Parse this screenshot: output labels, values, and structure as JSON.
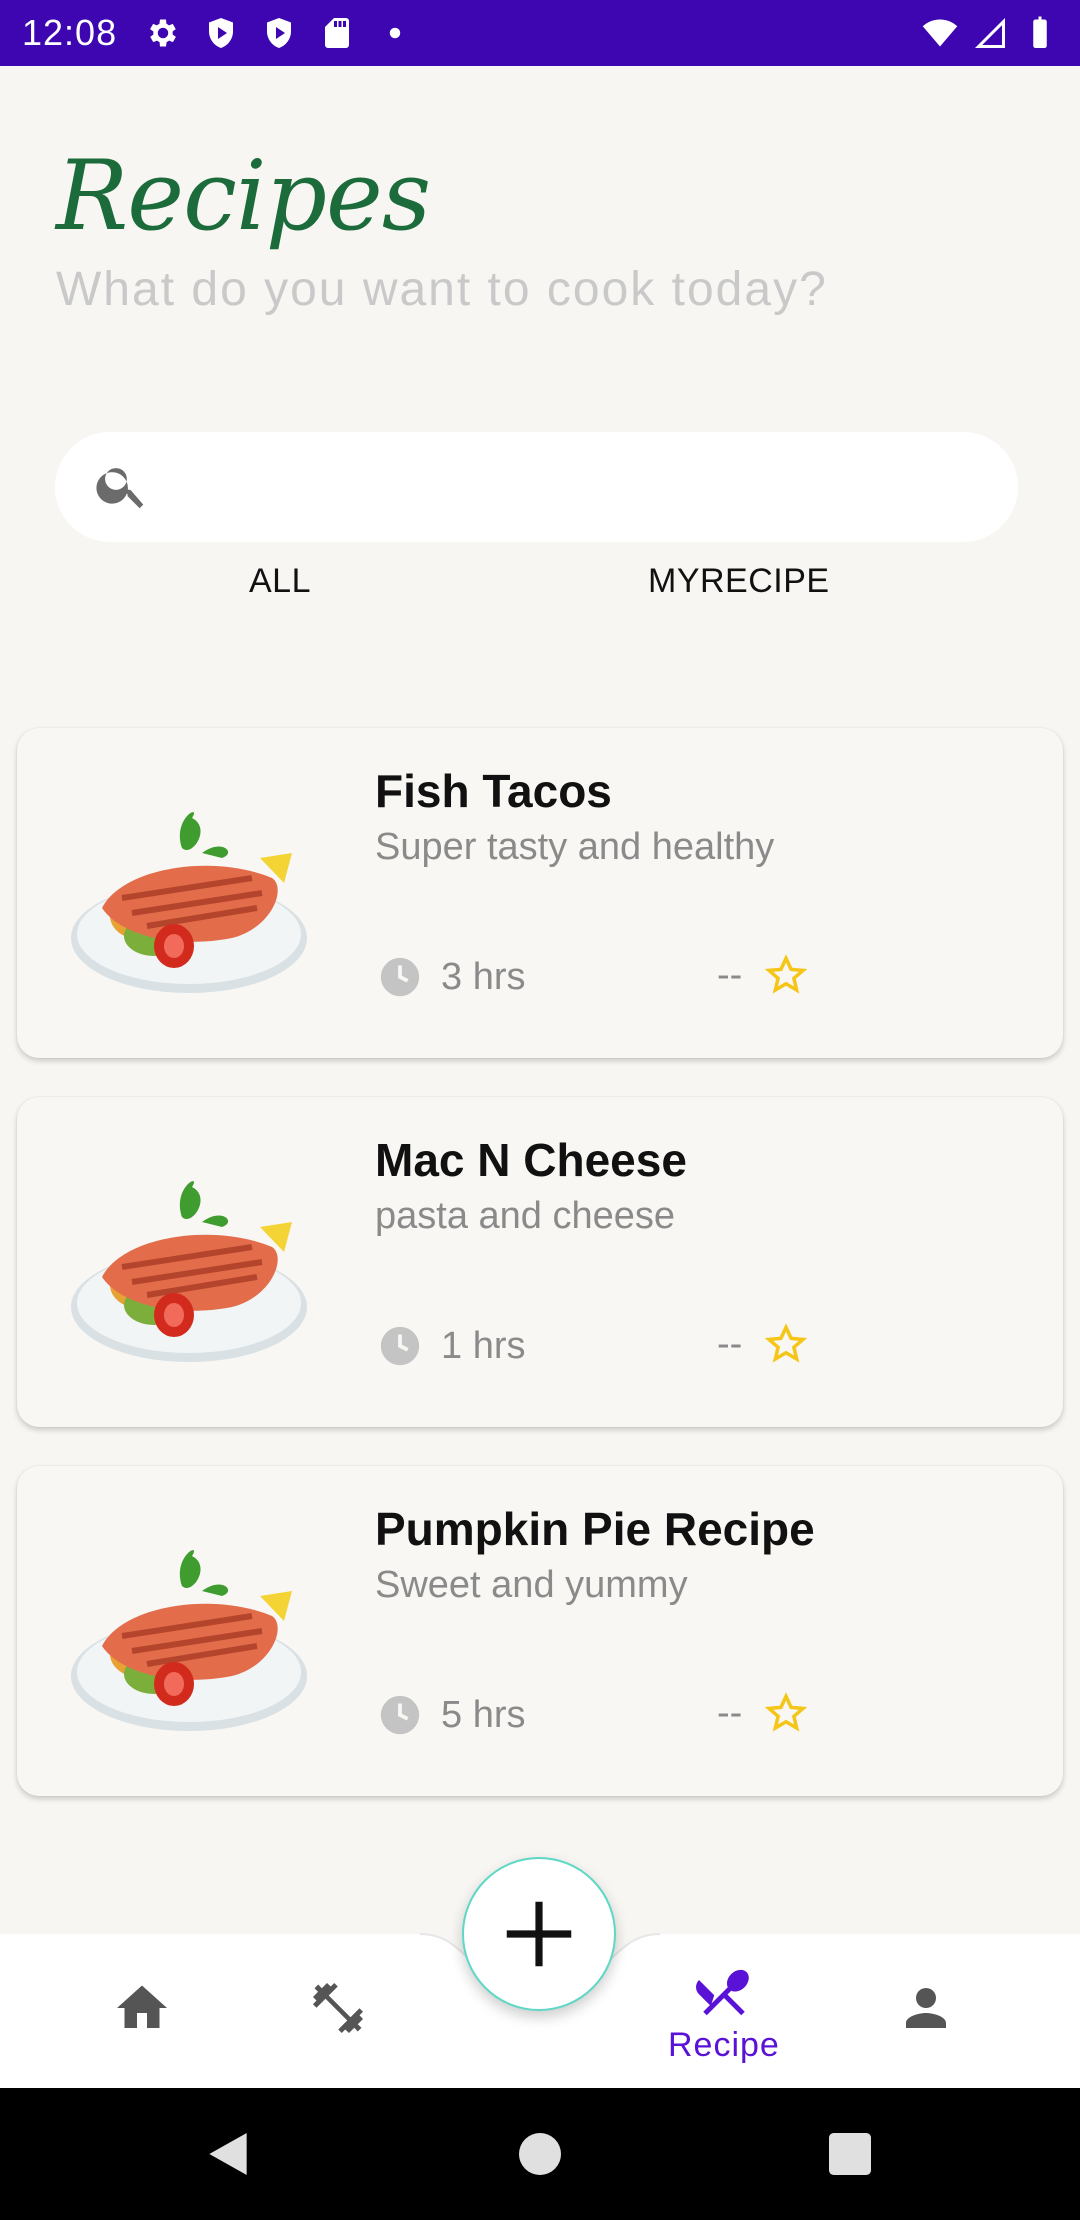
{
  "status_bar": {
    "time": "12:08",
    "left_icons": [
      "settings-icon",
      "shield-icon",
      "shield-icon",
      "sd-card-icon",
      "dot-icon"
    ],
    "right_icons": [
      "wifi-icon",
      "signal-icon",
      "battery-icon"
    ]
  },
  "header": {
    "title": "Recipes",
    "subtitle": "What do you want to cook today?"
  },
  "search": {
    "placeholder": "",
    "value": ""
  },
  "tabs": [
    {
      "label": "ALL"
    },
    {
      "label": "MYRECIPE"
    }
  ],
  "recipes": [
    {
      "title": "Fish Tacos",
      "description": "Super tasty and healthy",
      "time": "3 hrs",
      "rating": "--"
    },
    {
      "title": "Mac N Cheese",
      "description": "pasta and cheese",
      "time": "1 hrs",
      "rating": "--"
    },
    {
      "title": "Pumpkin Pie Recipe",
      "description": "Sweet and yummy",
      "time": "5 hrs",
      "rating": "--"
    }
  ],
  "bottom_nav": {
    "items": [
      {
        "icon": "home-icon"
      },
      {
        "icon": "dumbbell-icon"
      },
      {
        "icon": "fork-knife-icon",
        "label": "Recipe",
        "active": true
      },
      {
        "icon": "person-icon"
      }
    ],
    "fab_icon": "plus-icon"
  },
  "colors": {
    "status_bar": "#3d06b0",
    "title_green": "#1c6b3a",
    "accent_purple": "#5a12d6",
    "star_yellow": "#f5c518",
    "fab_border": "#5fd7c6"
  }
}
